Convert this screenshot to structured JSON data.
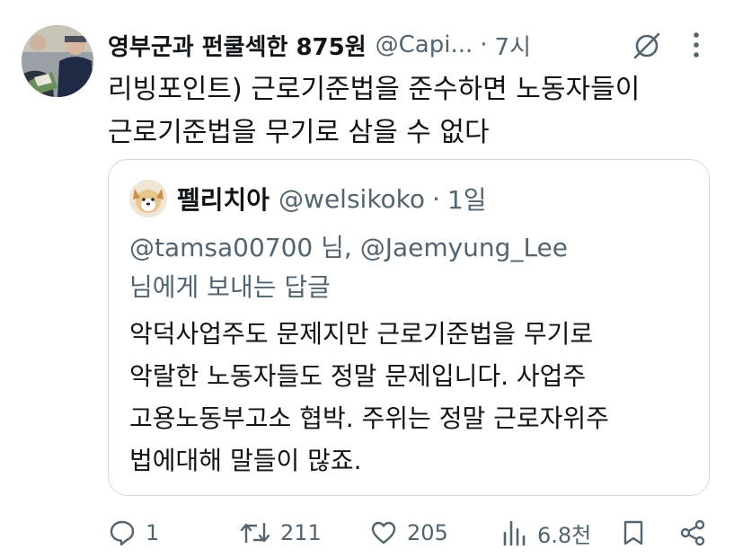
{
  "tweet": {
    "author_name": "영부군과 펀쿨섹한 875원",
    "handle": "@Capi...",
    "separator": "·",
    "time": "7시",
    "text_lines": [
      "리빙포인트) 근로기준법을 준수하면 노동자들이",
      "근로기준법을 무기로 삼을 수 없다"
    ]
  },
  "quote": {
    "author_name": "펠리치아",
    "handle": "@welsikoko",
    "separator": "·",
    "time": "1일",
    "reply_lines": [
      "@tamsa00700 님, @Jaemyung_Lee",
      "님에게 보내는 답글"
    ],
    "body_lines": [
      "악덕사업주도 문제지만 근로기준법을 무기로",
      "악랄한 노동자들도 정말 문제입니다. 사업주",
      "고용노동부고소 협박. 주위는 정말 근로자위주",
      "법에대해 말들이 많죠."
    ]
  },
  "actions": {
    "reply_count": "1",
    "repost_count": "211",
    "like_count": "205",
    "views_count": "6.8천"
  },
  "icons": {
    "grok": "grok-icon",
    "more": "more-icon",
    "reply": "reply-icon",
    "repost": "repost-icon",
    "like": "heart-icon",
    "views": "views-icon",
    "bookmark": "bookmark-icon",
    "share": "share-icon"
  },
  "colors": {
    "text": "#0f1419",
    "secondary": "#536471",
    "border": "#cfd9de"
  }
}
